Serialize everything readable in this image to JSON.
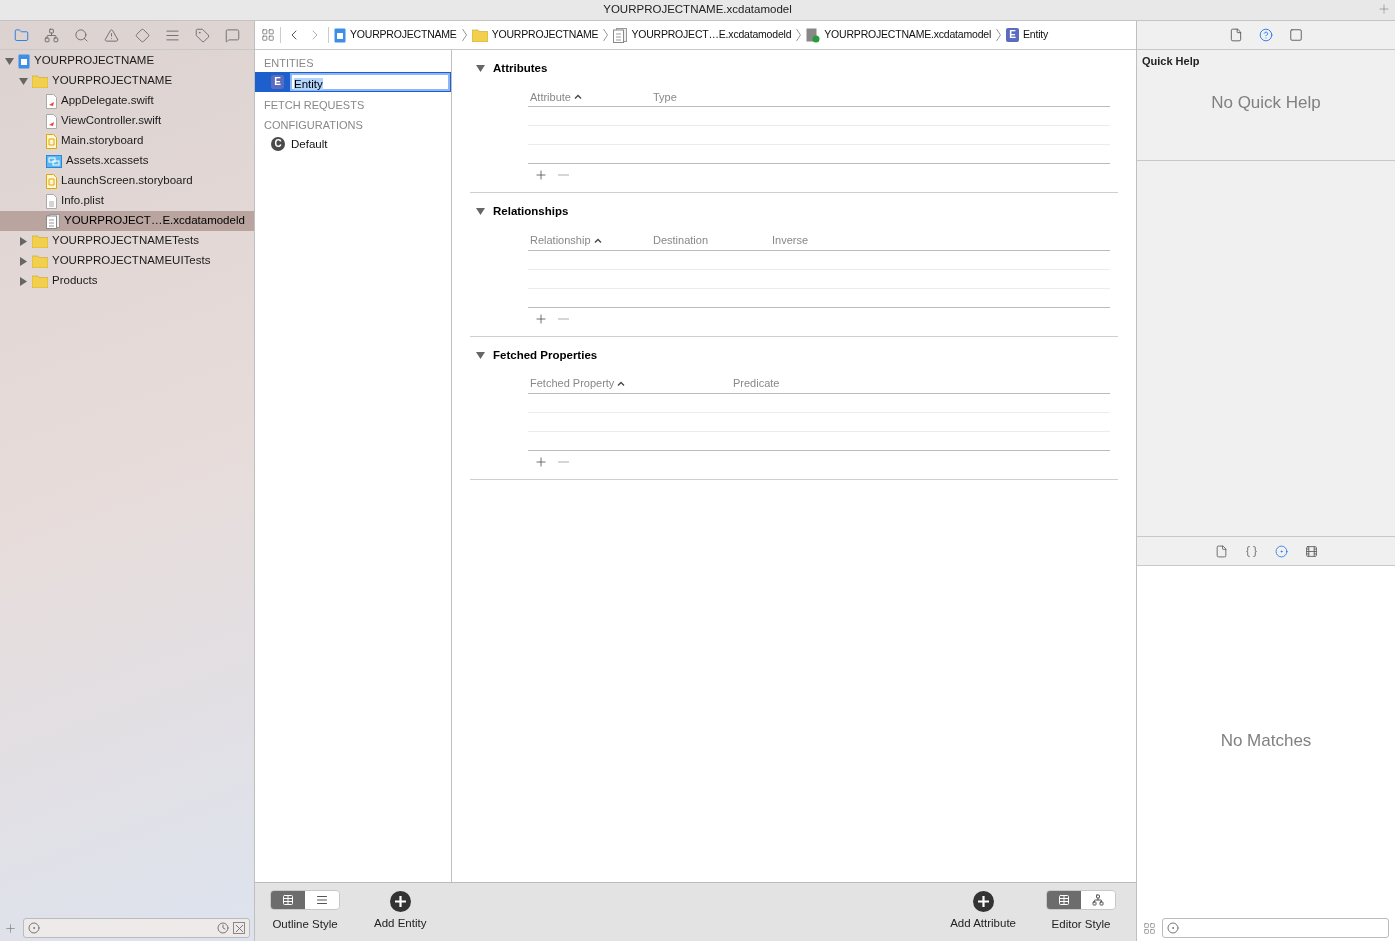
{
  "window": {
    "title": "YOURPROJECTNAME.xcdatamodel"
  },
  "navigator": {
    "tabs": [
      {
        "kind": "folder",
        "selected": true
      },
      {
        "kind": "hierarchy",
        "selected": false
      },
      {
        "kind": "search",
        "selected": false
      },
      {
        "kind": "warning",
        "selected": false
      },
      {
        "kind": "diamond",
        "selected": false
      },
      {
        "kind": "lines",
        "selected": false
      },
      {
        "kind": "tag",
        "selected": false
      },
      {
        "kind": "chat",
        "selected": false
      }
    ],
    "tree": [
      {
        "label": "YOURPROJECTNAME",
        "kind": "project",
        "expanded": true,
        "selected": false,
        "children": [
          {
            "label": "YOURPROJECTNAME",
            "kind": "folder",
            "expanded": true,
            "selected": false,
            "children": [
              {
                "label": "AppDelegate.swift",
                "kind": "swift",
                "selected": false
              },
              {
                "label": "ViewController.swift",
                "kind": "swift",
                "selected": false
              },
              {
                "label": "Main.storyboard",
                "kind": "storyboard",
                "selected": false
              },
              {
                "label": "Assets.xcassets",
                "kind": "assets",
                "selected": false
              },
              {
                "label": "LaunchScreen.storyboard",
                "kind": "storyboard",
                "selected": false
              },
              {
                "label": "Info.plist",
                "kind": "plist",
                "selected": false
              },
              {
                "label": "YOURPROJECT…E.xcdatamodeld",
                "kind": "datamodel",
                "selected": true
              }
            ]
          },
          {
            "label": "YOURPROJECTNAMETests",
            "kind": "folder",
            "expanded": false,
            "selected": false
          },
          {
            "label": "YOURPROJECTNAMEUITests",
            "kind": "folder",
            "expanded": false,
            "selected": false
          },
          {
            "label": "Products",
            "kind": "folder",
            "expanded": false,
            "selected": false
          }
        ]
      }
    ]
  },
  "breadcrumbs": [
    {
      "label": "YOURPROJECTNAME",
      "kind": "project"
    },
    {
      "label": "YOURPROJECTNAME",
      "kind": "folder"
    },
    {
      "label": "YOURPROJECT…E.xcdatamodeld",
      "kind": "datamodel"
    },
    {
      "label": "YOURPROJECTNAME.xcdatamodel",
      "kind": "model"
    },
    {
      "label": "Entity",
      "kind": "entity",
      "badge": "E"
    }
  ],
  "outline": {
    "sections": [
      {
        "title": "ENTITIES",
        "items": [
          {
            "label": "Entity",
            "kind": "entity",
            "badge": "E",
            "selected": true
          }
        ]
      },
      {
        "title": "FETCH REQUESTS"
      },
      {
        "title": "CONFIGURATIONS",
        "items": [
          {
            "label": "Default",
            "kind": "configuration",
            "badge": "C",
            "selected": false
          }
        ]
      }
    ]
  },
  "editor": {
    "sections": [
      {
        "title": "Attributes",
        "expanded": true,
        "columns": [
          {
            "label": "Attribute",
            "sorted": true
          },
          {
            "label": "Type",
            "sorted": false
          }
        ]
      },
      {
        "title": "Relationships",
        "expanded": true,
        "columns": [
          {
            "label": "Relationship",
            "sorted": true
          },
          {
            "label": "Destination",
            "sorted": false
          },
          {
            "label": "Inverse",
            "sorted": false
          }
        ]
      },
      {
        "title": "Fetched Properties",
        "expanded": true,
        "columns": [
          {
            "label": "Fetched Property",
            "sorted": true
          },
          {
            "label": "Predicate",
            "sorted": false
          }
        ]
      }
    ]
  },
  "bottom_bar": {
    "outline_style": {
      "label": "Outline Style",
      "segments": [
        {
          "kind": "table",
          "selected": true
        },
        {
          "kind": "list",
          "selected": false
        }
      ]
    },
    "add_entity": "Add Entity",
    "add_attribute": "Add Attribute",
    "editor_style": {
      "label": "Editor Style",
      "segments": [
        {
          "kind": "table",
          "selected": true
        },
        {
          "kind": "graph",
          "selected": false
        }
      ]
    }
  },
  "inspector": {
    "tabs": [
      {
        "kind": "file",
        "selected": false
      },
      {
        "kind": "help",
        "selected": true
      },
      {
        "kind": "identity",
        "selected": false
      }
    ],
    "title": "Quick Help",
    "message": "No Quick Help",
    "library_tabs": [
      {
        "kind": "file",
        "selected": false
      },
      {
        "kind": "braces",
        "selected": false
      },
      {
        "kind": "object",
        "selected": true
      },
      {
        "kind": "media",
        "selected": false
      }
    ],
    "library_message": "No Matches"
  }
}
